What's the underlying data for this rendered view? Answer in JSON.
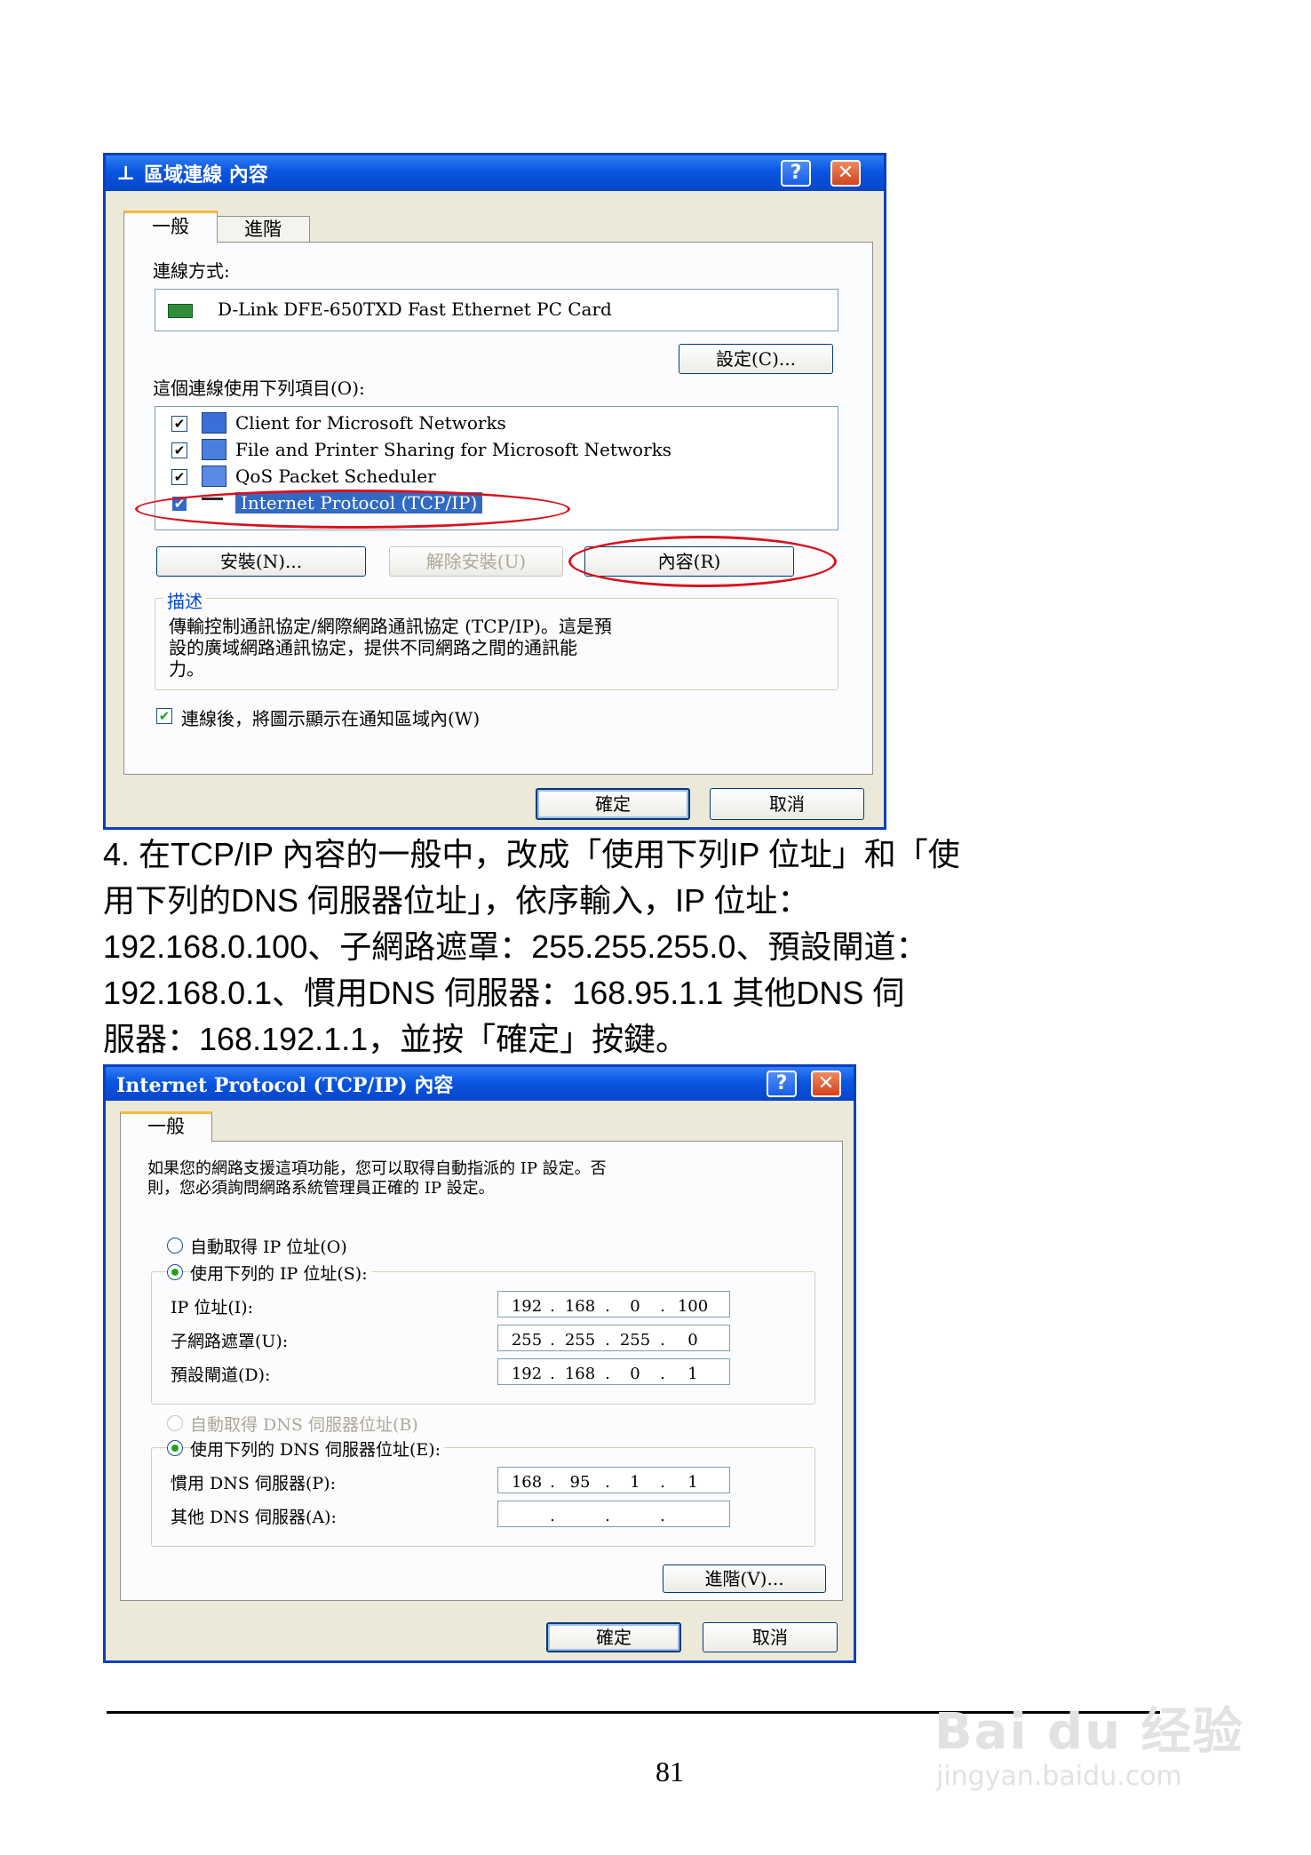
{
  "dialog1": {
    "title": "區域連線 內容",
    "help_label": "?",
    "close_label": "✕",
    "tabs": [
      "一般",
      "進階"
    ],
    "connect_using_label": "連線方式:",
    "adapter_name": "D-Link DFE-650TXD Fast Ethernet PC Card",
    "configure_label": "設定(C)...",
    "items_label": "這個連線使用下列項目(O):",
    "items": [
      {
        "label": "Client for Microsoft Networks",
        "checked": true,
        "icon": "network-client-icon"
      },
      {
        "label": "File and Printer Sharing for Microsoft Networks",
        "checked": true,
        "icon": "printer-sharing-icon"
      },
      {
        "label": "QoS Packet Scheduler",
        "checked": true,
        "icon": "qos-scheduler-icon"
      },
      {
        "label": "Internet Protocol (TCP/IP)",
        "checked": true,
        "selected": true,
        "icon": "protocol-icon"
      }
    ],
    "install_label": "安裝(N)...",
    "uninstall_label": "解除安裝(U)",
    "properties_label": "內容(R)",
    "description_title": "描述",
    "description_lines": [
      "傳輸控制通訊協定/網際網路通訊協定 (TCP/IP)。這是預",
      "設的廣域網路通訊協定，提供不同網路之間的通訊能",
      "力。"
    ],
    "show_icon_label": "連線後，將圖示顯示在通知區域內(W)",
    "ok_label": "確定",
    "cancel_label": "取消"
  },
  "instruction": {
    "lines": [
      "4. 在TCP/IP 內容的一般中，改成「使用下列IP 位址」和「使",
      "用下列的DNS 伺服器位址」，依序輸入，IP 位址：",
      "192.168.0.100、子網路遮罩：255.255.255.0、預設閘道：",
      "192.168.0.1、慣用DNS 伺服器：168.95.1.1 其他DNS 伺",
      "服器：168.192.1.1，並按「確定」按鍵。"
    ]
  },
  "dialog2": {
    "title": "Internet Protocol (TCP/IP) 內容",
    "help_label": "?",
    "close_label": "✕",
    "tab": "一般",
    "info_lines": [
      "如果您的網路支援這項功能，您可以取得自動指派的 IP 設定。否",
      "則，您必須詢問網路系統管理員正確的 IP 設定。"
    ],
    "auto_ip_label": "自動取得 IP 位址(O)",
    "manual_ip_label": "使用下列的 IP 位址(S):",
    "ip_label": "IP 位址(I):",
    "ip_value": [
      "192",
      "168",
      "0",
      "100"
    ],
    "subnet_label": "子網路遮罩(U):",
    "subnet_value": [
      "255",
      "255",
      "255",
      "0"
    ],
    "gateway_label": "預設閘道(D):",
    "gateway_value": [
      "192",
      "168",
      "0",
      "1"
    ],
    "auto_dns_label": "自動取得 DNS 伺服器位址(B)",
    "manual_dns_label": "使用下列的 DNS 伺服器位址(E):",
    "preferred_dns_label": "慣用 DNS 伺服器(P):",
    "preferred_dns_value": [
      "168",
      "95",
      "1",
      "1"
    ],
    "alternate_dns_label": "其他 DNS 伺服器(A):",
    "alternate_dns_value": [
      "",
      "",
      "",
      ""
    ],
    "advanced_label": "進階(V)...",
    "ok_label": "確定",
    "cancel_label": "取消"
  },
  "page_number": "81",
  "watermark": {
    "brand": "Bai du 经验",
    "url": "jingyan.baidu.com"
  }
}
